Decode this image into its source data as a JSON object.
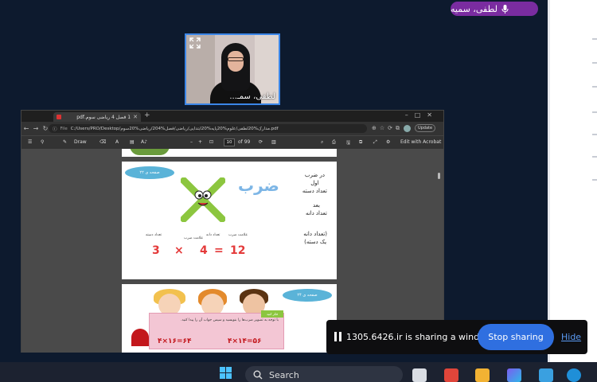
{
  "meeting": {
    "participant_badge_name": "لطفی، سمیه",
    "video_tile_name": "لطفی، سمـ...",
    "colors": {
      "badge": "#7a2ca0",
      "tile_border": "#3b86e8"
    }
  },
  "browser": {
    "tab_title": "1 فصل 4 ریاضی سوم.pdf",
    "url_prefix": "File",
    "url": "C:/Users/PRO/Desktop/مدارک%20لطفی/علوم%20پایه%20ابتدایی/ریاضی/فصل%204/ریاضی%20سوم.pdf",
    "update_label": "Update",
    "toolbar": {
      "draw_label": "Draw",
      "page_current": "10",
      "page_total": "of 99",
      "acrobat_label": "Edit with Acrobat"
    }
  },
  "pdf_page_1": {
    "badge": "صفحه ی ۲۲",
    "title": "ضرب",
    "rule_lines_1": [
      "در ضرب",
      "اول",
      "تعداد دسته"
    ],
    "rule_lines_2": [
      "بعد",
      "تعداد دانه"
    ],
    "rule_lines_3": [
      "(تعداد دانه",
      "یک دسته)"
    ],
    "label_count_groups": "تعداد دسته",
    "label_multiply_sign": "علامت ضرب",
    "label_count_items": "تعداد دانه",
    "label_multiply_sign_2": "علامت ضرب",
    "equation": {
      "a": "3",
      "op": "×",
      "b": "4",
      "eq": "=",
      "result": "12"
    }
  },
  "pdf_page_2": {
    "badge": "صفحه ی ۲۴",
    "card_tag": "فکر کنید",
    "card_text": "با توجه به تصویر ضرب‌ها را بنویسید و سپس جواب آن را پیدا کنید.",
    "card_num_left": "۴×۱۶=۶۴",
    "card_num_right": "۴×۱۴=۵۶"
  },
  "share_bar": {
    "message": "1305.6426.ir is sharing a window.",
    "stop_label": "Stop sharing",
    "hide_label": "Hide",
    "colors": {
      "stop_button": "#2f6fe0",
      "hide_link": "#5b9bf5"
    }
  },
  "taskbar": {
    "search_label": "Search"
  }
}
